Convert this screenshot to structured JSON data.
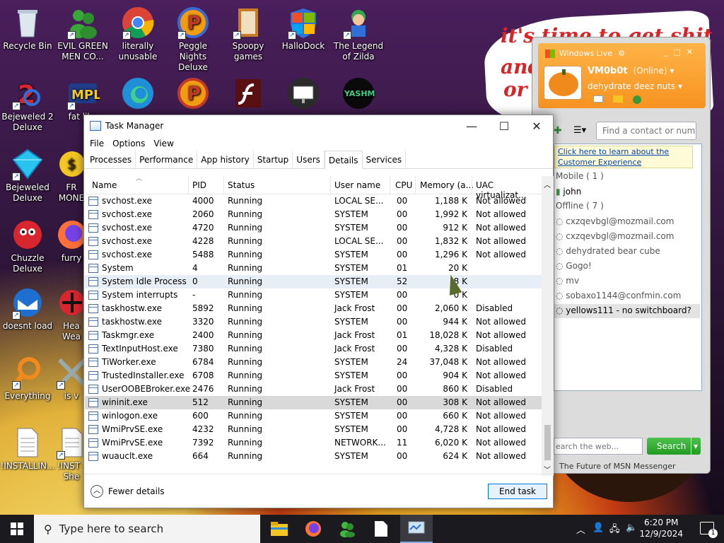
{
  "desktop": {
    "sign_lines": [
      "it's time to get shit",
      "and",
      "or t"
    ],
    "icons": [
      {
        "label": "Recycle Bin",
        "icon": "recycle-bin-icon"
      },
      {
        "label": "EVIL GREEN MEN CO...",
        "icon": "green-men-icon"
      },
      {
        "label": "literally unusable",
        "icon": "chrome-icon"
      },
      {
        "label": "Peggle Nights Deluxe",
        "icon": "peggle-icon"
      },
      {
        "label": "Spoopy games",
        "icon": "folder-icon"
      },
      {
        "label": "HalloDock",
        "icon": "windows-shield-icon"
      },
      {
        "label": "The Legend of Zilda",
        "icon": "zilda-icon"
      },
      {
        "label": "Bejeweled 2 Deluxe",
        "icon": "bejeweled2-icon"
      },
      {
        "label": "fat like",
        "icon": "mpl-icon"
      },
      {
        "label": "",
        "icon": "edge-icon"
      },
      {
        "label": "",
        "icon": "peggle-icon"
      },
      {
        "label": "",
        "icon": "flash-icon"
      },
      {
        "label": "",
        "icon": "monitor-shield-icon"
      },
      {
        "label": "",
        "icon": "yashma-icon"
      },
      {
        "label": "Bejeweled Deluxe",
        "icon": "bejeweled-icon"
      },
      {
        "label": "FR MONE",
        "icon": "money-icon"
      },
      {
        "label": "Chuzzle Deluxe",
        "icon": "chuzzle-icon"
      },
      {
        "label": "furry",
        "icon": "firefox-icon"
      },
      {
        "label": "doesnt load",
        "icon": "thunderbird-icon"
      },
      {
        "label": "Hea Wea",
        "icon": "weather-icon"
      },
      {
        "label": "Everything",
        "icon": "everything-icon"
      },
      {
        "label": "is v",
        "icon": "game-icon"
      },
      {
        "label": "!INSTALLIN...",
        "icon": "text-file-icon"
      },
      {
        "label": "!INST - She",
        "icon": "text-file-icon"
      }
    ]
  },
  "task_manager": {
    "title": "Task Manager",
    "menu": [
      "File",
      "Options",
      "View"
    ],
    "tabs": [
      "Processes",
      "Performance",
      "App history",
      "Startup",
      "Users",
      "Details",
      "Services"
    ],
    "active_tab": "Details",
    "columns": [
      "Name",
      "PID",
      "Status",
      "User name",
      "CPU",
      "Memory (a...",
      "UAC virtualizat..."
    ],
    "rows": [
      [
        "svchost.exe",
        "4000",
        "Running",
        "LOCAL SE...",
        "00",
        "1,188 K",
        "Not allowed"
      ],
      [
        "svchost.exe",
        "2060",
        "Running",
        "SYSTEM",
        "00",
        "1,992 K",
        "Not allowed"
      ],
      [
        "svchost.exe",
        "4720",
        "Running",
        "SYSTEM",
        "00",
        "912 K",
        "Not allowed"
      ],
      [
        "svchost.exe",
        "4228",
        "Running",
        "LOCAL SE...",
        "00",
        "1,832 K",
        "Not allowed"
      ],
      [
        "svchost.exe",
        "5488",
        "Running",
        "SYSTEM",
        "00",
        "1,296 K",
        "Not allowed"
      ],
      [
        "System",
        "4",
        "Running",
        "SYSTEM",
        "01",
        "20 K",
        ""
      ],
      [
        "System Idle Process",
        "0",
        "Running",
        "SYSTEM",
        "52",
        "8 K",
        ""
      ],
      [
        "System interrupts",
        "-",
        "Running",
        "SYSTEM",
        "00",
        "0 K",
        ""
      ],
      [
        "taskhostw.exe",
        "5892",
        "Running",
        "Jack Frost",
        "00",
        "2,060 K",
        "Disabled"
      ],
      [
        "taskhostw.exe",
        "3320",
        "Running",
        "SYSTEM",
        "00",
        "944 K",
        "Not allowed"
      ],
      [
        "Taskmgr.exe",
        "2400",
        "Running",
        "Jack Frost",
        "01",
        "18,028 K",
        "Not allowed"
      ],
      [
        "TextInputHost.exe",
        "7380",
        "Running",
        "Jack Frost",
        "00",
        "4,328 K",
        "Disabled"
      ],
      [
        "TiWorker.exe",
        "6784",
        "Running",
        "SYSTEM",
        "24",
        "37,048 K",
        "Not allowed"
      ],
      [
        "TrustedInstaller.exe",
        "6708",
        "Running",
        "SYSTEM",
        "00",
        "904 K",
        "Not allowed"
      ],
      [
        "UserOOBEBroker.exe",
        "2476",
        "Running",
        "Jack Frost",
        "00",
        "860 K",
        "Disabled"
      ],
      [
        "wininit.exe",
        "512",
        "Running",
        "SYSTEM",
        "00",
        "308 K",
        "Not allowed"
      ],
      [
        "winlogon.exe",
        "600",
        "Running",
        "SYSTEM",
        "00",
        "660 K",
        "Not allowed"
      ],
      [
        "WmiPrvSE.exe",
        "4232",
        "Running",
        "SYSTEM",
        "00",
        "4,728 K",
        "Not allowed"
      ],
      [
        "WmiPrvSE.exe",
        "7392",
        "Running",
        "NETWORK...",
        "11",
        "6,020 K",
        "Not allowed"
      ],
      [
        "wuauclt.exe",
        "664",
        "Running",
        "SYSTEM",
        "00",
        "624 K",
        "Not allowed"
      ]
    ],
    "fewer_details": "Fewer details",
    "end_task": "End task"
  },
  "messenger": {
    "title": "Windows Live",
    "username": "VM0b0t",
    "status": "(Online)",
    "personal_message": "dehydrate deez nuts",
    "search_placeholder": "Find a contact or numbe",
    "promo_line1": "Click here to learn about the",
    "promo_line2": "Customer Experience",
    "groups": [
      {
        "name": "Mobile ( 1 )",
        "contacts": [
          "john"
        ]
      },
      {
        "name": "Offline ( 7 )",
        "contacts": [
          "cxzqevbgl@mozmail.com",
          "cxzqevbgl@mozmail.com",
          "dehydrated bear cube",
          "Gogo!",
          "mv",
          "sobaxo1144@confmin.com",
          "yellows111 - no switchboard?"
        ]
      }
    ],
    "web_search_placeholder": "earch the web...",
    "search_button": "Search",
    "footer": "The Future of MSN Messenger"
  },
  "taskbar": {
    "search_placeholder": "Type here to search",
    "time": "6:20 PM",
    "date": "12/9/2024",
    "notification_count": "1",
    "apps": [
      "file-explorer-icon",
      "firefox-icon",
      "messenger-icon",
      "document-icon",
      "task-manager-icon"
    ]
  }
}
